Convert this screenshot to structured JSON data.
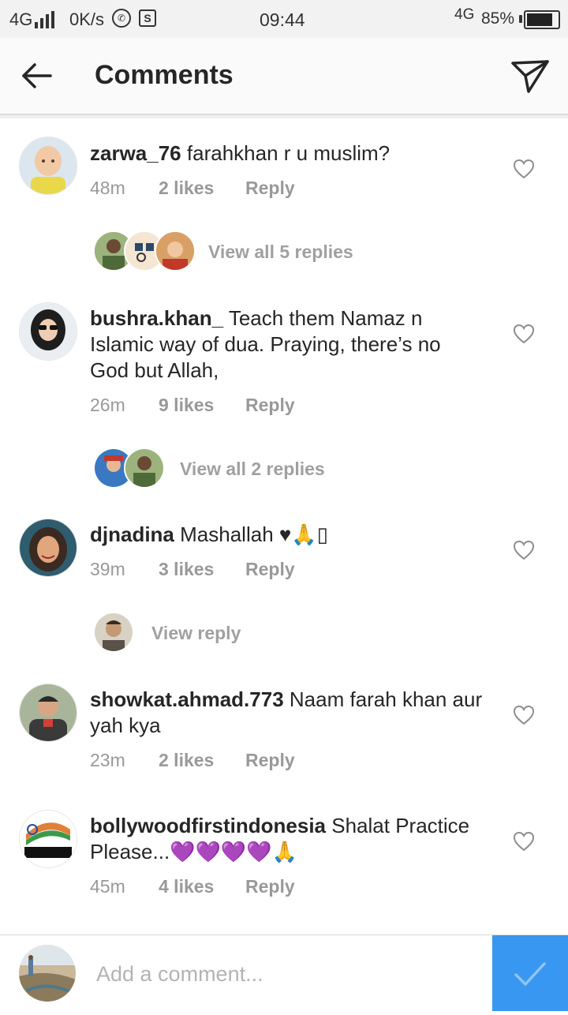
{
  "status_bar": {
    "network": "4G",
    "speed": "0K/s",
    "time": "09:44",
    "network_right": "4G",
    "battery": "85%",
    "battery_level": 0.85
  },
  "header": {
    "title": "Comments"
  },
  "comments": [
    {
      "username": "zarwa_76",
      "text": "farahkhan r u muslim?",
      "time": "48m",
      "likes": "2 likes",
      "reply_label": "Reply",
      "view_replies": "View all 5 replies"
    },
    {
      "username": "bushra.khan_",
      "text": "Teach them Namaz n Islamic way of dua. Praying, there’s no God but Allah,",
      "time": "26m",
      "likes": "9 likes",
      "reply_label": "Reply",
      "view_replies": "View all 2 replies"
    },
    {
      "username": "djnadina",
      "text": "Mashallah ♥🙏▯",
      "time": "39m",
      "likes": "3 likes",
      "reply_label": "Reply",
      "view_replies": "View reply"
    },
    {
      "username": "showkat.ahmad.773",
      "text": "Naam farah khan aur yah kya",
      "time": "23m",
      "likes": "2 likes",
      "reply_label": "Reply"
    },
    {
      "username": "bollywoodfirstindonesia",
      "text": "Shalat Practice Please...💜💜💜💜🙏",
      "time": "45m",
      "likes": "4 likes",
      "reply_label": "Reply"
    }
  ],
  "composer": {
    "placeholder": "Add a comment..."
  },
  "colors": {
    "accent": "#3897f0",
    "meta_gray": "#999999",
    "heart_outline": "#8e8e8e"
  },
  "icons": [
    "back-arrow-icon",
    "send-direct-icon",
    "heart-outline-icon",
    "checkmark-icon",
    "whatsapp-icon",
    "s-app-icon",
    "signal-icon",
    "battery-icon"
  ]
}
